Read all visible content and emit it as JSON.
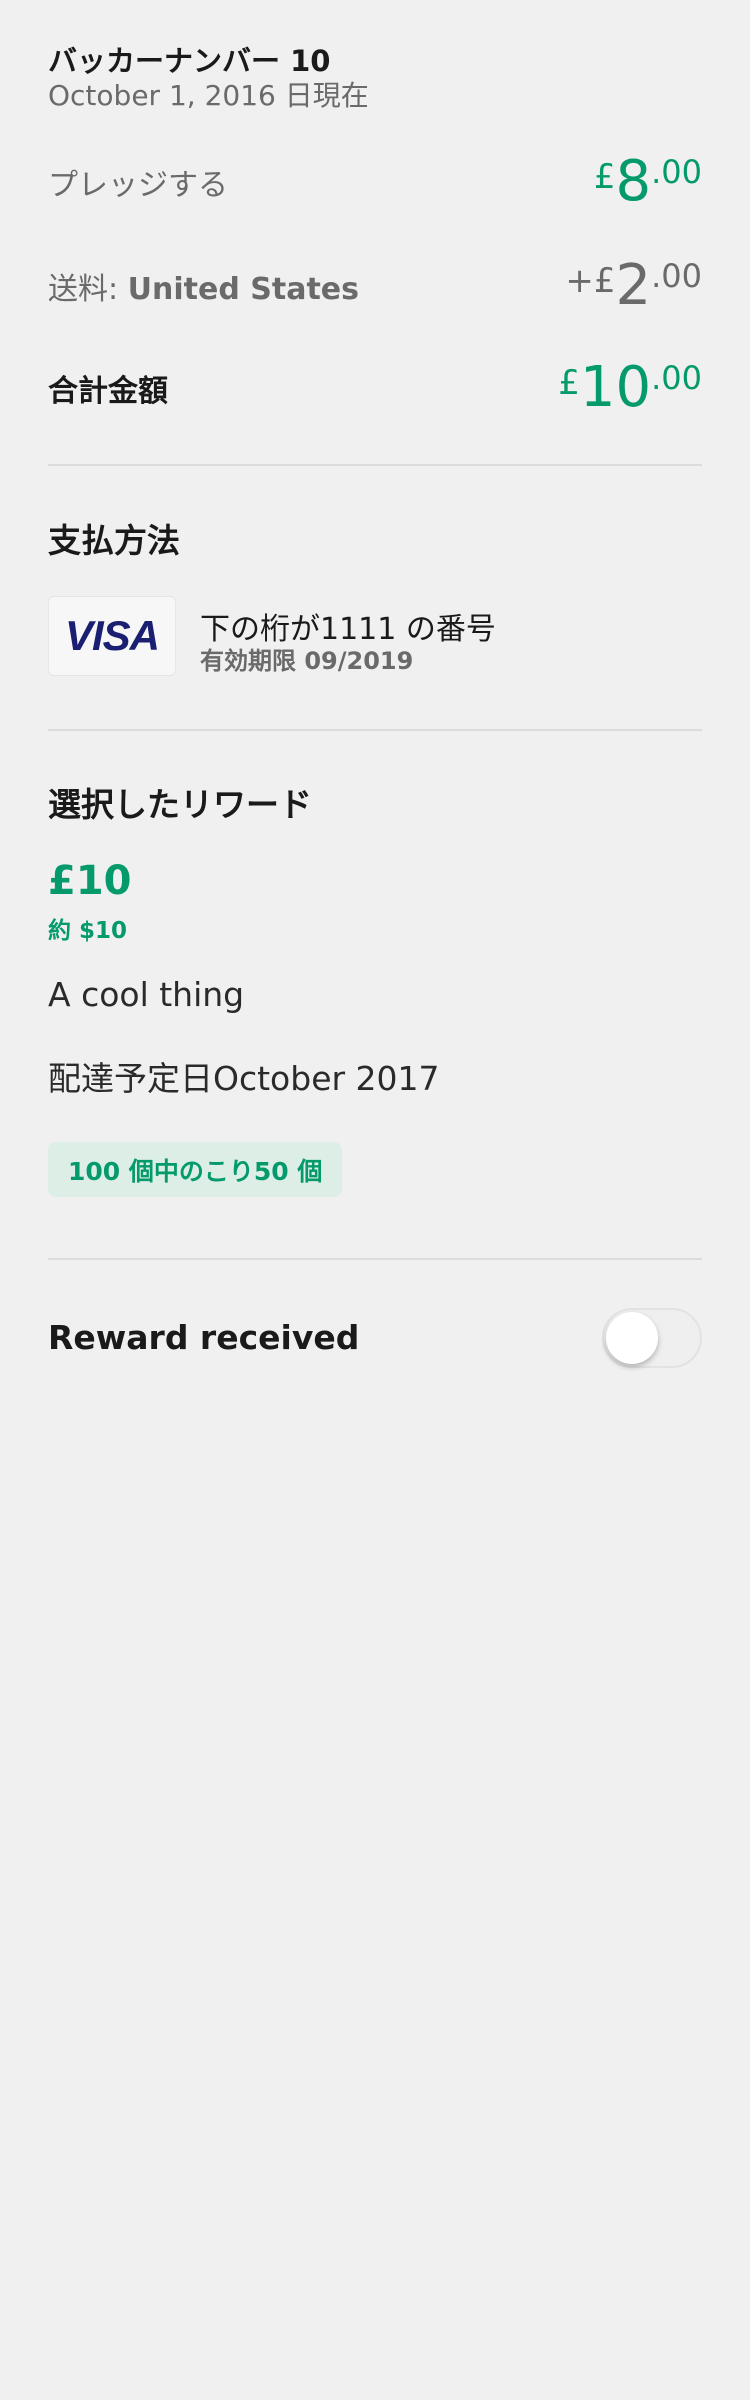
{
  "header": {
    "backer_title": "バッカーナンバー 10",
    "as_of": "October 1, 2016 日現在"
  },
  "pledge": {
    "label": "プレッジする",
    "currency": "£",
    "whole": "8",
    "cents": ".00"
  },
  "shipping": {
    "label": "送料:",
    "destination": "United States",
    "prefix": "+£",
    "whole": "2",
    "cents": ".00"
  },
  "total": {
    "label": "合計金額",
    "currency": "£",
    "whole": "10",
    "cents": ".00"
  },
  "payment": {
    "section_title": "支払方法",
    "card_brand": "VISA",
    "card_number_text": "下の桁が1111 の番号",
    "expiry_text": "有効期限 09/2019"
  },
  "reward": {
    "section_title": "選択したリワード",
    "amount": "£10",
    "approx": "約 $10",
    "name": "A cool thing",
    "delivery": "配達予定日October 2017",
    "remaining": "100 個中のこり50 個"
  },
  "reward_received": {
    "label": "Reward received",
    "toggle_on": false
  },
  "colors": {
    "accent": "#059a6b",
    "background": "#f0f0f0",
    "visa_blue": "#1a1f71"
  }
}
